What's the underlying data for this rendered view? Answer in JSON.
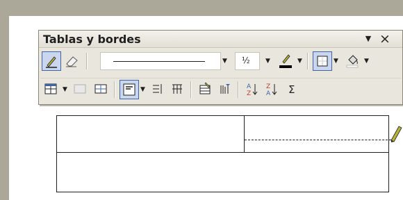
{
  "toolbar": {
    "title": "Tablas y bordes",
    "line_weight": "½",
    "colors": {
      "active_btn_bg": "#c9d6ee",
      "active_btn_border": "#3e64a8",
      "pencil": "#b7b23b",
      "border_color_swatch": "#000000"
    },
    "icons": {
      "row1": [
        "draw-table-pencil-icon",
        "eraser-icon",
        "line-style-dropdown",
        "line-weight-dropdown",
        "border-color-icon",
        "outside-border-icon",
        "shading-color-icon"
      ],
      "row2": [
        "insert-table-icon",
        "merge-cells-icon",
        "split-cells-icon",
        "align-top-left-icon",
        "distribute-rows-icon",
        "distribute-columns-icon",
        "table-autoformat-icon",
        "text-direction-icon",
        "sort-ascending-icon",
        "sort-descending-icon",
        "autosum-icon"
      ]
    }
  }
}
